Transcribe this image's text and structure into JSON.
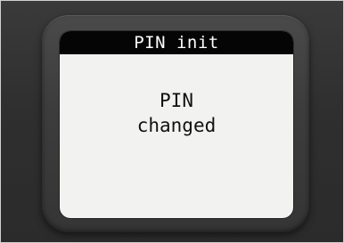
{
  "screen": {
    "title": "PIN init",
    "message_lines": [
      "PIN",
      "changed"
    ]
  },
  "colors": {
    "device_body": "#2f2f2f",
    "bezel": "#3d3d3d",
    "title_bar": "#050505",
    "title_text": "#ffffff",
    "screen_background": "#f2f2f0",
    "message_text": "#111111"
  }
}
